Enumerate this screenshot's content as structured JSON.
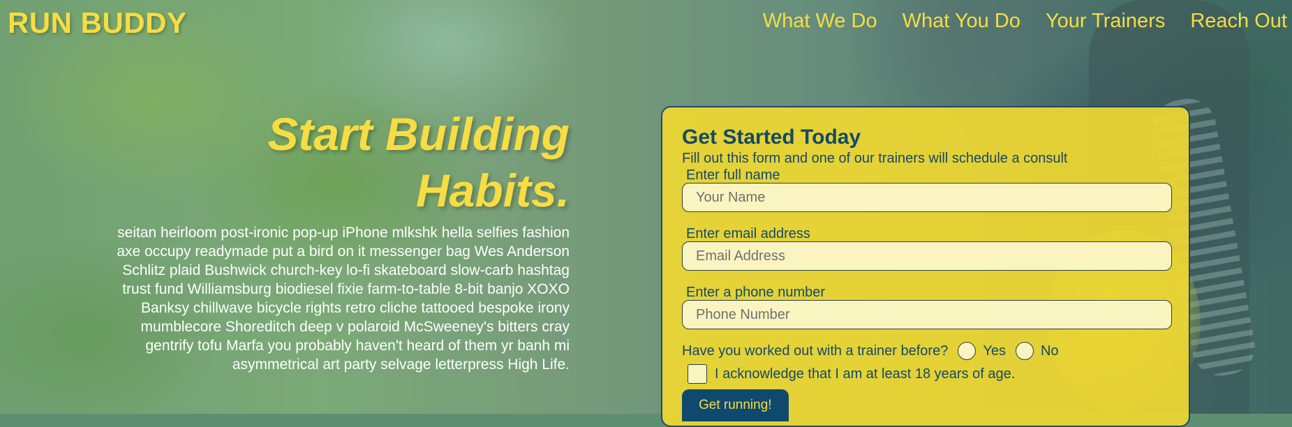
{
  "header": {
    "logo": "RUN BUDDY",
    "nav": [
      "What We Do",
      "What You Do",
      "Your Trainers",
      "Reach Out"
    ]
  },
  "hero": {
    "title_line1": "Start Building",
    "title_line2": "Habits.",
    "description": "seitan heirloom post-ironic pop-up iPhone mlkshk hella selfies fashion axe occupy readymade put a bird on it messenger bag Wes Anderson Schlitz plaid Bushwick church-key lo-fi skateboard slow-carb hashtag trust fund Williamsburg biodiesel fixie farm-to-table 8-bit banjo XOXO Banksy chillwave bicycle rights retro cliche tattooed bespoke irony mumblecore Shoreditch deep v polaroid McSweeney's bitters cray gentrify tofu Marfa you probably haven't heard of them yr banh mi asymmetrical art party selvage letterpress High Life."
  },
  "form": {
    "title": "Get Started Today",
    "subtitle": "Fill out this form and one of our trainers will schedule a consult",
    "name_label": "Enter full name",
    "name_placeholder": "Your Name",
    "email_label": "Enter email address",
    "email_placeholder": "Email Address",
    "phone_label": "Enter a phone number",
    "phone_placeholder": "Phone Number",
    "question": "Have you worked out with a trainer before?",
    "yes_label": "Yes",
    "no_label": "No",
    "ack_label": "I acknowledge that I am at least 18 years of age.",
    "submit_label": "Get running!"
  },
  "colors": {
    "accent_yellow": "#f7dd43",
    "dark_blue": "#144a66",
    "button_blue": "#0f4a6e"
  }
}
